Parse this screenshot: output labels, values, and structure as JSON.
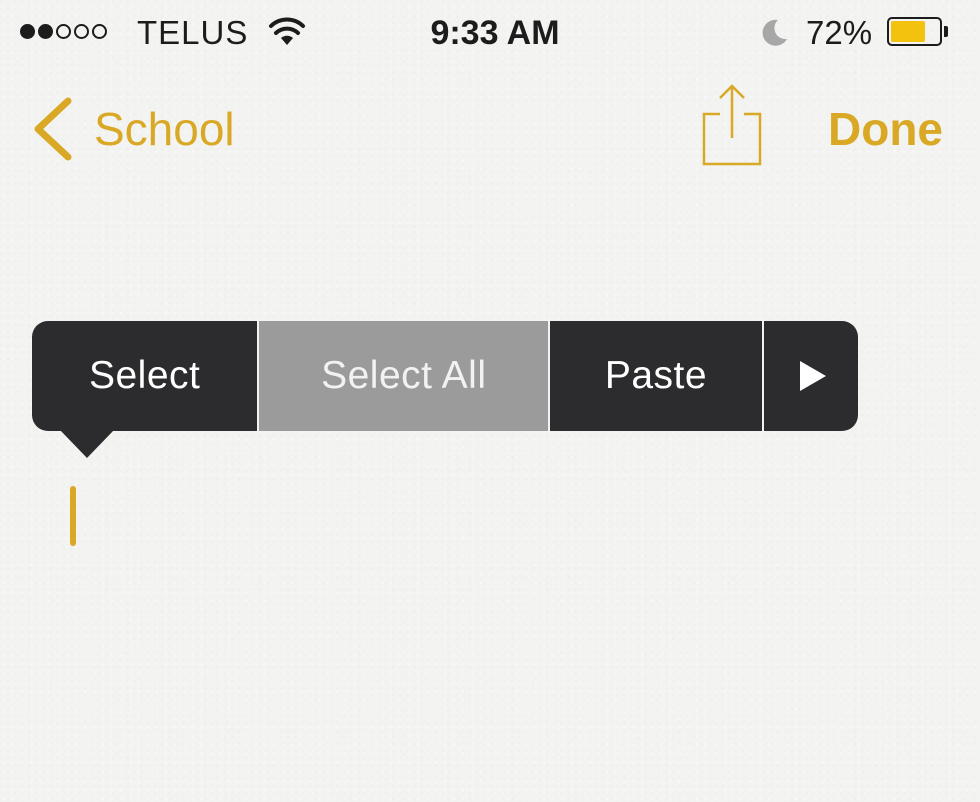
{
  "status_bar": {
    "carrier": "TELUS",
    "signal_strength_of_5": 2,
    "time": "9:33 AM",
    "battery_percent_label": "72%",
    "battery_level": 0.72,
    "battery_color": "#f2c20e",
    "icons": [
      "signal-dots",
      "wifi-icon",
      "moon-icon",
      "battery-icon"
    ]
  },
  "nav": {
    "back_label": "School",
    "back_icon": "chevron-left-icon",
    "share_icon": "share-icon",
    "done_label": "Done",
    "accent_color": "#d9a926"
  },
  "edit_menu": {
    "items": [
      {
        "label": "Select"
      },
      {
        "label": "Select All",
        "highlighted": true
      },
      {
        "label": "Paste"
      }
    ],
    "more_icon": "play-right-icon"
  },
  "text_cursor_color": "#d9a926"
}
